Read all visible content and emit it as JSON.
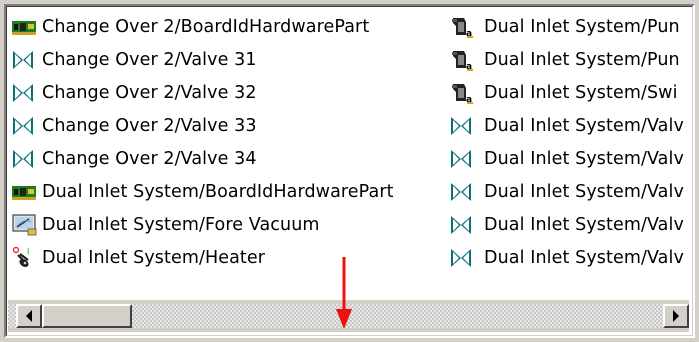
{
  "left_column": [
    {
      "label": "Change Over 2/BoardIdHardwarePart",
      "icon": "board-icon"
    },
    {
      "label": "Change Over 2/Valve 31",
      "icon": "valve-icon"
    },
    {
      "label": "Change Over 2/Valve 32",
      "icon": "valve-icon"
    },
    {
      "label": "Change Over 2/Valve 33",
      "icon": "valve-icon"
    },
    {
      "label": "Change Over 2/Valve 34",
      "icon": "valve-icon"
    },
    {
      "label": "Dual Inlet System/BoardIdHardwarePart",
      "icon": "board-icon"
    },
    {
      "label": "Dual Inlet System/Fore Vacuum",
      "icon": "vacuum-gauge-icon"
    },
    {
      "label": "Dual Inlet System/Heater",
      "icon": "heater-icon"
    }
  ],
  "right_column": [
    {
      "label": "Dual Inlet System/Pun",
      "icon": "pump-icon"
    },
    {
      "label": "Dual Inlet System/Pun",
      "icon": "pump-icon"
    },
    {
      "label": "Dual Inlet System/Swi",
      "icon": "pump-icon"
    },
    {
      "label": "Dual Inlet System/Valv",
      "icon": "valve-icon"
    },
    {
      "label": "Dual Inlet System/Valv",
      "icon": "valve-icon"
    },
    {
      "label": "Dual Inlet System/Valv",
      "icon": "valve-icon"
    },
    {
      "label": "Dual Inlet System/Valv",
      "icon": "valve-icon"
    },
    {
      "label": "Dual Inlet System/Valv",
      "icon": "valve-icon"
    }
  ],
  "colors": {
    "valve": "#0a6f78",
    "board": "#1a7f1a",
    "annotation_arrow": "#ee1111"
  }
}
